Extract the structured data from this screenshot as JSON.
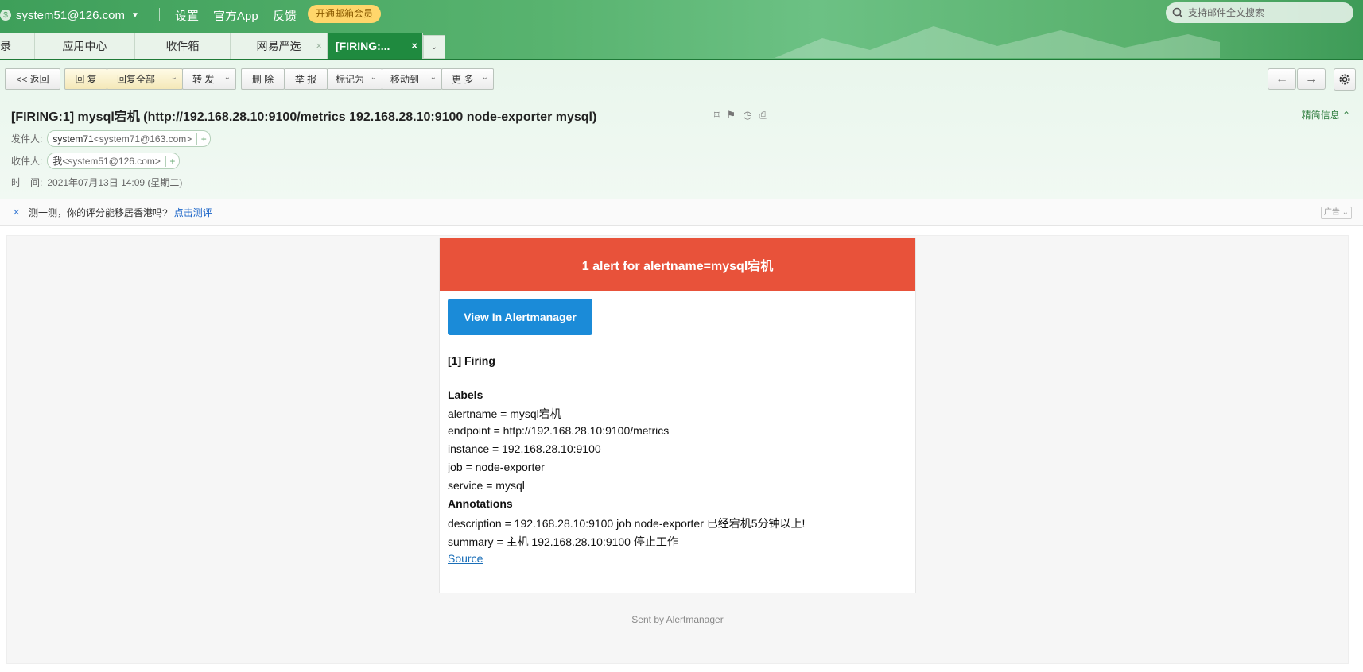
{
  "topbar": {
    "account": "system51@126.com",
    "links": [
      "设置",
      "官方App",
      "反馈"
    ],
    "vip": "开通邮箱会员",
    "search_placeholder": "支持邮件全文搜索"
  },
  "tabs": [
    "录",
    "应用中心",
    "收件箱",
    "网易严选",
    "[FIRING:..."
  ],
  "toolbar": {
    "back": "<< 返回",
    "reply": "回 复",
    "reply_all": "回复全部",
    "forward": "转 发",
    "delete": "删 除",
    "report": "举 报",
    "mark": "标记为",
    "move": "移动到",
    "more": "更 多"
  },
  "mail": {
    "subject": "[FIRING:1] mysql宕机 (http://192.168.28.10:9100/metrics 192.168.28.10:9100 node-exporter mysql)",
    "brief_label": "精简信息",
    "from_label": "发件人:",
    "from_name": "system71",
    "from_addr": "<system71@163.com>",
    "to_label": "收件人:",
    "to_name": "我",
    "to_addr": "<system51@126.com>",
    "time_label": "时　间:",
    "time_value": "2021年07月13日 14:09 (星期二)"
  },
  "ad": {
    "text": "测一测，你的评分能移居香港吗?",
    "link": "点击测评",
    "tag": "广告"
  },
  "alert": {
    "header": "1 alert for alertname=mysql宕机",
    "button": "View In Alertmanager",
    "firing": "[1] Firing",
    "labels_title": "Labels",
    "labels": [
      "alertname = mysql宕机",
      "endpoint = http://192.168.28.10:9100/metrics",
      "instance = 192.168.28.10:9100",
      "job = node-exporter",
      "service = mysql"
    ],
    "annotations_title": "Annotations",
    "annotations": [
      "description = 192.168.28.10:9100 job node-exporter 已经宕机5分钟以上!",
      "summary = 主机 192.168.28.10:9100 停止工作"
    ],
    "source": "Source",
    "sent_by": "Sent by Alertmanager"
  }
}
